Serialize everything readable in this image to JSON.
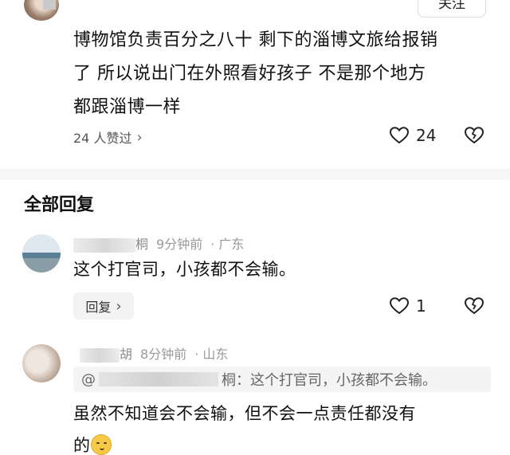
{
  "post": {
    "follow_label": "关注",
    "content_lines": [
      "博物馆负责百分之八十 剩下的淄博文旅给报销",
      "了 所以说出门在外照看好孩子 不是那个地方",
      "都跟淄博一样"
    ],
    "likers_text": "24 人赞过",
    "like_count": "24"
  },
  "replies_section": {
    "title": "全部回复"
  },
  "replies": [
    {
      "name_visible": "桐",
      "time": "9分钟前",
      "location": "· 广东",
      "text": "这个打官司，小孩都不会输。",
      "reply_label": "回复",
      "like_count": "1"
    },
    {
      "name_visible": "胡",
      "time": "8分钟前",
      "location": "· 山东",
      "quote_prefix": "@",
      "quote_suffix": "桐：这个打官司，小孩都不会输。",
      "text_line1": "虽然不知道会不会输，但不会一点责任都没有",
      "text_line2": "的"
    }
  ],
  "icons": {
    "heart": "heart-outline-icon",
    "dislike": "broken-heart-icon",
    "chevron": "chevron-right-icon"
  }
}
